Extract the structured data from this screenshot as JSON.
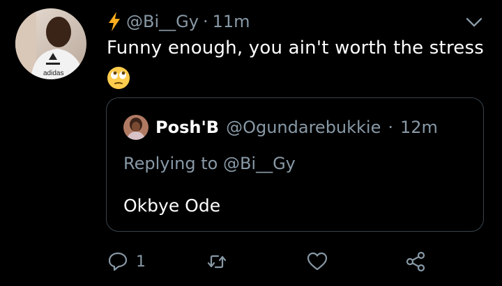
{
  "tweet": {
    "handle": "@Bi__Gy",
    "separator": "·",
    "time": "11m",
    "text": "Funny enough, you ain't worth the stress",
    "emoji": "face-with-rolling-eyes",
    "avatar_caption": "adidas"
  },
  "quoted": {
    "name": "Posh'B",
    "handle": "@Ogundarebukkie",
    "separator": "·",
    "time": "12m",
    "replying_prefix": "Replying to",
    "replying_to": "@Bi__Gy",
    "text": "Okbye Ode"
  },
  "actions": {
    "reply_count": "1"
  },
  "colors": {
    "background": "#000000",
    "muted": "#8899a6",
    "border": "#38444d",
    "bolt": "#ffad1f"
  }
}
